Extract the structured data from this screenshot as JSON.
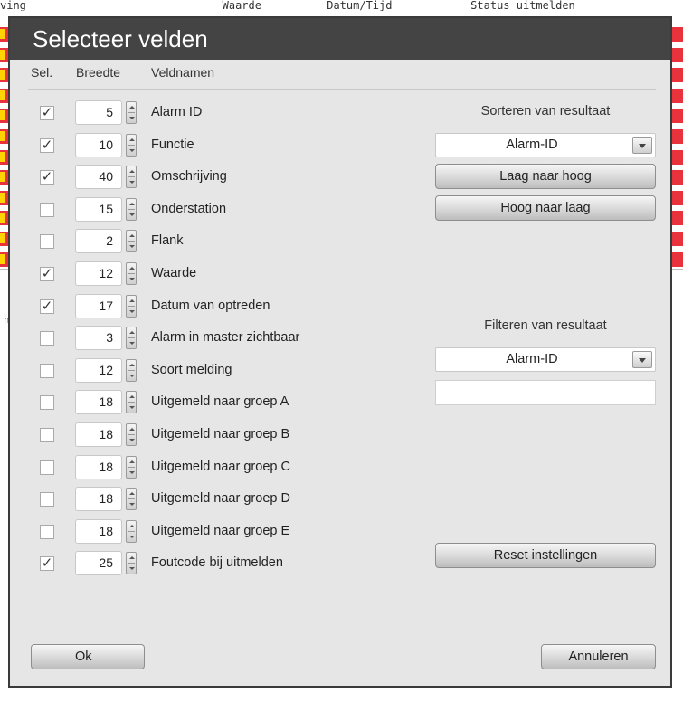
{
  "background": {
    "header_text": "ving                              Waarde          Datum/Tijd            Status uitmelden",
    "row_count": 12
  },
  "dialog": {
    "title": "Selecteer velden",
    "columns": {
      "sel": "Sel.",
      "width": "Breedte",
      "names": "Veldnamen"
    },
    "fields": [
      {
        "checked": true,
        "width": "5",
        "name": "Alarm ID"
      },
      {
        "checked": true,
        "width": "10",
        "name": "Functie"
      },
      {
        "checked": true,
        "width": "40",
        "name": "Omschrijving"
      },
      {
        "checked": false,
        "width": "15",
        "name": "Onderstation"
      },
      {
        "checked": false,
        "width": "2",
        "name": "Flank"
      },
      {
        "checked": true,
        "width": "12",
        "name": "Waarde"
      },
      {
        "checked": true,
        "width": "17",
        "name": "Datum van optreden"
      },
      {
        "checked": false,
        "width": "3",
        "name": "Alarm in master zichtbaar"
      },
      {
        "checked": false,
        "width": "12",
        "name": "Soort melding"
      },
      {
        "checked": false,
        "width": "18",
        "name": "Uitgemeld naar groep A"
      },
      {
        "checked": false,
        "width": "18",
        "name": "Uitgemeld naar groep B"
      },
      {
        "checked": false,
        "width": "18",
        "name": "Uitgemeld naar groep C"
      },
      {
        "checked": false,
        "width": "18",
        "name": "Uitgemeld naar groep D"
      },
      {
        "checked": false,
        "width": "18",
        "name": "Uitgemeld naar groep E"
      },
      {
        "checked": true,
        "width": "25",
        "name": "Foutcode bij uitmelden"
      }
    ],
    "sort": {
      "label": "Sorteren van resultaat",
      "selected": "Alarm-ID",
      "ascending": "Laag naar hoog",
      "descending": "Hoog naar laag"
    },
    "filter": {
      "label": "Filteren van resultaat",
      "selected": "Alarm-ID",
      "value": ""
    },
    "reset_label": "Reset instellingen",
    "ok_label": "Ok",
    "cancel_label": "Annuleren"
  },
  "icons": {
    "checkbox_checked_glyph": "✓",
    "spinner": "spinner-icon",
    "dropdown": "chevron-down-icon"
  }
}
